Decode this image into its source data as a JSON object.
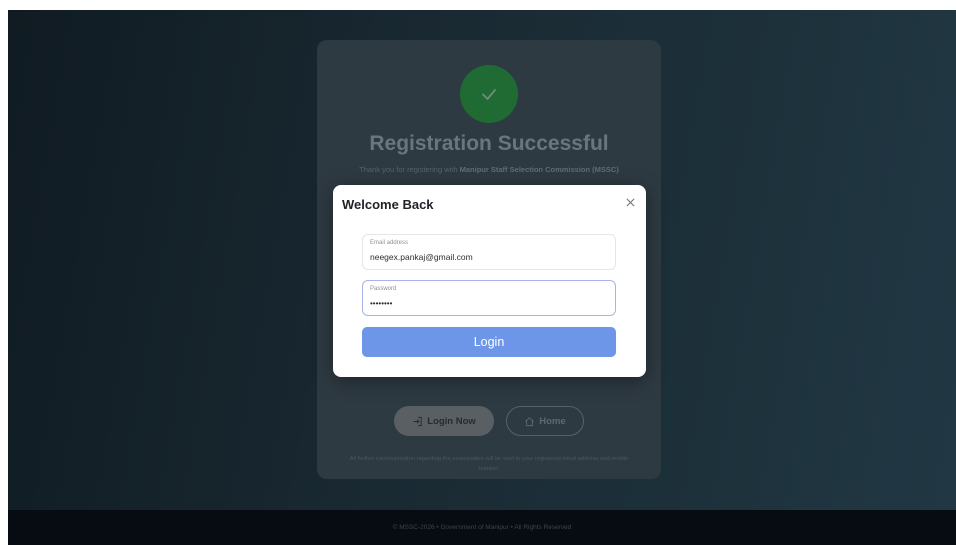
{
  "card": {
    "title": "Registration Successful",
    "subtitle_prefix": "Thank you for registering with",
    "subtitle_org": "Manipur Staff Selection Commission (MSSC)",
    "login_now_label": "Login Now",
    "home_label": "Home",
    "note": "All further communication regarding the examination will be sent to your registered email address and mobile number."
  },
  "modal": {
    "title": "Welcome Back",
    "email_label": "Email address",
    "email_value": "neegex.pankaj@gmail.com",
    "password_label": "Password",
    "password_value": "••••••••",
    "login_label": "Login"
  },
  "footer": {
    "text": "© MSSC-2026 • Government of Manipur • All Rights Reserved"
  },
  "colors": {
    "accent": "#6d95e8",
    "success": "#1f6b33"
  },
  "icons": {
    "success": "checkmark-icon",
    "close": "close-icon",
    "login": "login-icon",
    "home": "home-icon"
  }
}
